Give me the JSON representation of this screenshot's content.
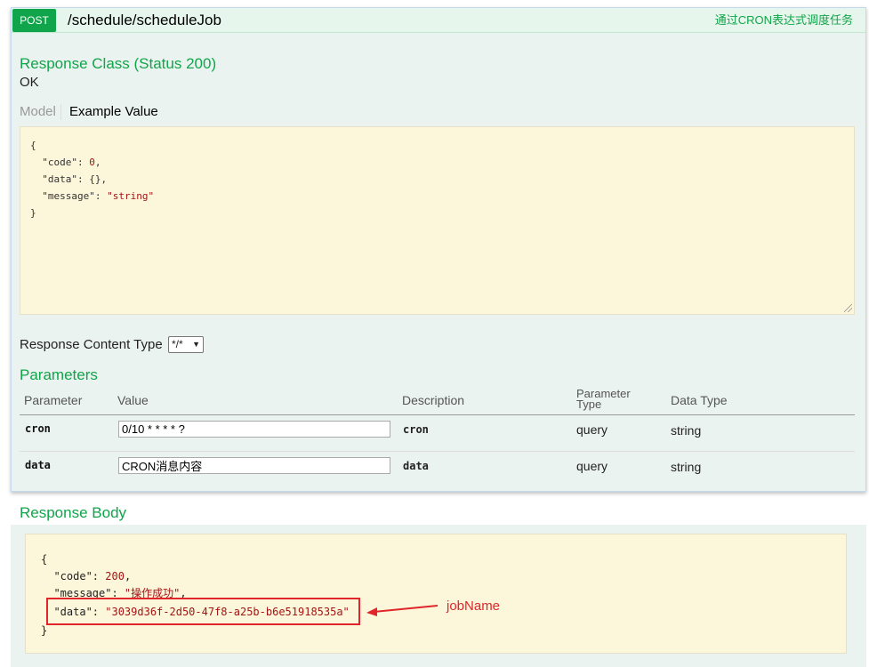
{
  "operation": {
    "method": "POST",
    "path": "/schedule/scheduleJob",
    "summary": "通过CRON表达式调度任务"
  },
  "response_class": {
    "title": "Response Class (Status 200)",
    "status_text": "OK",
    "tabs": [
      "Model",
      "Example Value"
    ]
  },
  "example_value": {
    "lines": [
      [
        "{",
        "",
        ""
      ],
      [
        "  \"code\": ",
        "0",
        ","
      ],
      [
        "  \"data\": ",
        "{}",
        ","
      ],
      [
        "  \"message\": ",
        "\"string\"",
        ""
      ],
      [
        "}",
        "",
        ""
      ]
    ]
  },
  "content_type": {
    "label": "Response Content Type",
    "selected": "*/*"
  },
  "parameters": {
    "title": "Parameters",
    "headers": [
      "Parameter",
      "Value",
      "Description",
      "Parameter Type",
      "Data Type"
    ],
    "header_type_line1": "Parameter",
    "header_type_line2": "Type",
    "rows": [
      {
        "name": "cron",
        "value": "0/10 * * * * ?",
        "description": "cron",
        "type": "query",
        "data_type": "string"
      },
      {
        "name": "data",
        "value": "CRON消息内容",
        "description": "data",
        "type": "query",
        "data_type": "string"
      }
    ]
  },
  "response_body": {
    "title": "Response Body",
    "open": "{",
    "code_key": "  \"code\": ",
    "code_val": "200",
    "message_key": "  \"message\": ",
    "message_val": "\"操作成功\"",
    "data_key": "  \"data\": ",
    "data_val": "\"3039d36f-2d50-47f8-a25b-b6e51918535a\"",
    "close": "}"
  },
  "annotation": {
    "label": "jobName",
    "color": "#e0262b"
  },
  "colors": {
    "accent_green": "#10a54a",
    "sample_bg": "#fcf6db",
    "panel_bg": "#ebf3f0"
  }
}
